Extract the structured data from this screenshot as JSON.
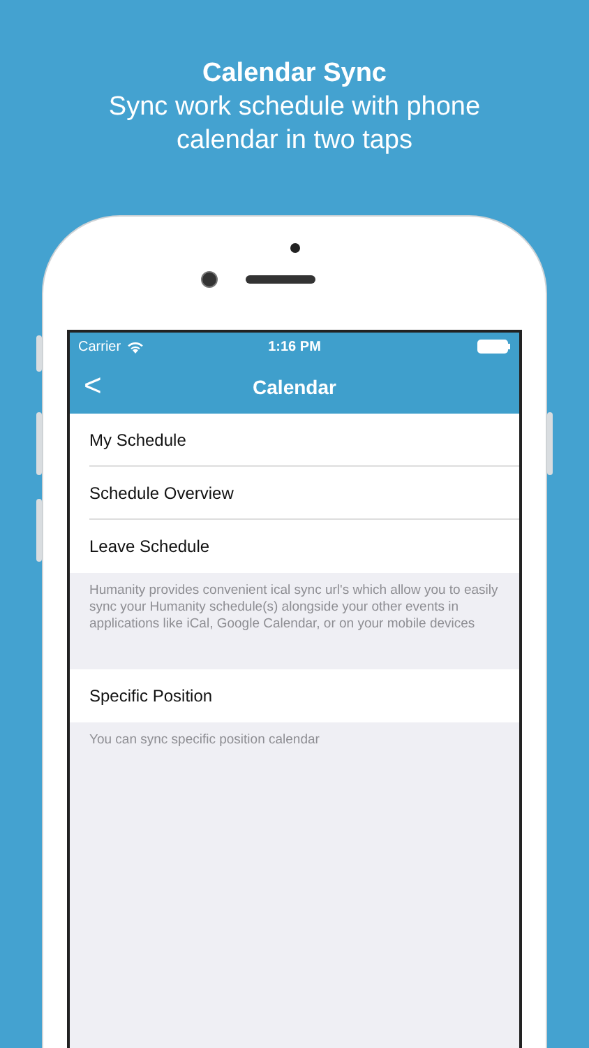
{
  "headline": {
    "title": "Calendar Sync",
    "subtitle": "Sync work schedule with phone calendar in two taps"
  },
  "status_bar": {
    "carrier": "Carrier",
    "time": "1:16 PM"
  },
  "nav_bar": {
    "back": "<",
    "title": "Calendar"
  },
  "sections": [
    {
      "rows": [
        "My Schedule",
        "Schedule Overview",
        "Leave Schedule"
      ],
      "footer": "Humanity provides convenient ical sync url's which allow you to easily sync your Humanity schedule(s) alongside your other events in applications like iCal, Google Calendar, or on your mobile devices"
    },
    {
      "rows": [
        "Specific Position"
      ],
      "footer": "You can sync specific position calendar"
    }
  ]
}
